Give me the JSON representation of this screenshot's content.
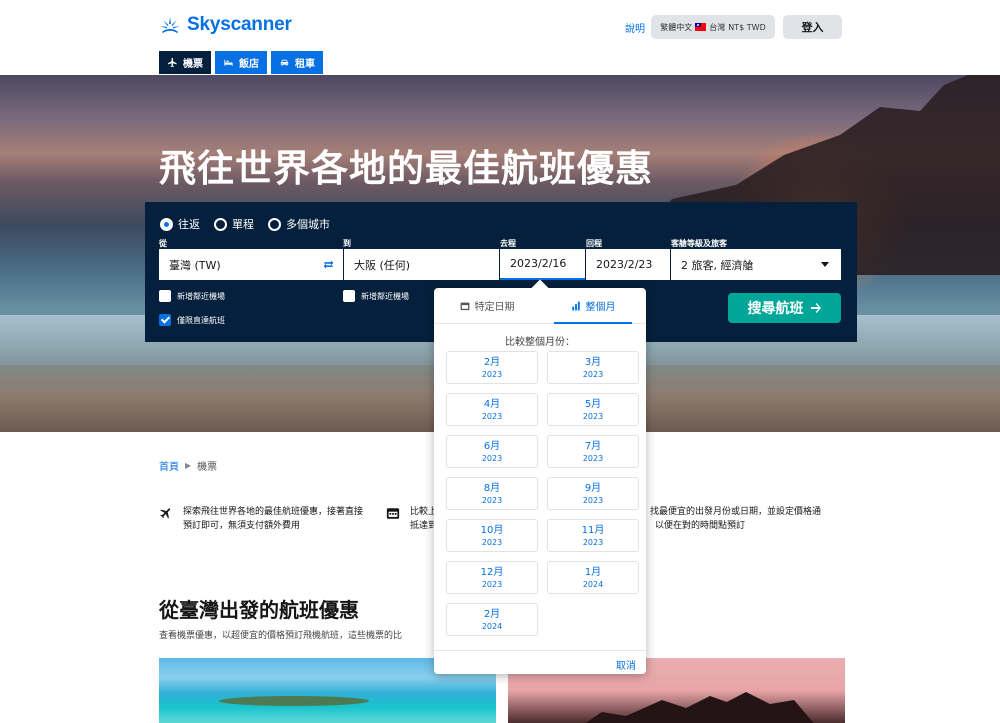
{
  "brand": {
    "name": "Skyscanner",
    "accent": "#0770e3",
    "navy": "#05203c",
    "teal": "#00a698"
  },
  "header": {
    "help": "說明",
    "locale": {
      "language": "繁體中文",
      "region": "台灣",
      "currency": "NT$ TWD"
    },
    "login": "登入"
  },
  "tabs": [
    {
      "label": "機票",
      "icon": "plane-icon",
      "active": true
    },
    {
      "label": "飯店",
      "icon": "bed-icon",
      "active": false
    },
    {
      "label": "租車",
      "icon": "car-icon",
      "active": false
    }
  ],
  "hero": {
    "title": "飛往世界各地的最佳航班優惠"
  },
  "search": {
    "trip_types": [
      {
        "label": "往返",
        "checked": true
      },
      {
        "label": "單程",
        "checked": false
      },
      {
        "label": "多個城市",
        "checked": false
      }
    ],
    "labels": {
      "from": "從",
      "to": "到",
      "depart": "去程",
      "return": "回程",
      "cabin": "客艙等級及旅客"
    },
    "values": {
      "from": "臺灣 (TW)",
      "to": "大阪 (任何)",
      "depart": "2023/2/16",
      "return": "2023/2/23",
      "cabin": "2 旅客, 經濟艙"
    },
    "checkboxes": [
      {
        "label": "新增鄰近機場",
        "checked": false
      },
      {
        "label": "新增鄰近機場",
        "checked": false
      },
      {
        "label": "僅限直達航班",
        "checked": true
      }
    ],
    "submit": "搜尋航班"
  },
  "date_popup": {
    "tabs": [
      {
        "label": "特定日期",
        "icon": "calendar-icon",
        "active": false
      },
      {
        "label": "整個月",
        "icon": "bar-chart-icon",
        "active": true
      }
    ],
    "heading": "比較整個月份：",
    "months": [
      {
        "month": "2月",
        "year": "2023"
      },
      {
        "month": "3月",
        "year": "2023"
      },
      {
        "month": "4月",
        "year": "2023"
      },
      {
        "month": "5月",
        "year": "2023"
      },
      {
        "month": "6月",
        "year": "2023"
      },
      {
        "month": "7月",
        "year": "2023"
      },
      {
        "month": "8月",
        "year": "2023"
      },
      {
        "month": "9月",
        "year": "2023"
      },
      {
        "month": "10月",
        "year": "2023"
      },
      {
        "month": "11月",
        "year": "2023"
      },
      {
        "month": "12月",
        "year": "2023"
      },
      {
        "month": "1月",
        "year": "2024"
      },
      {
        "month": "2月",
        "year": "2024"
      }
    ],
    "cancel": "取消"
  },
  "breadcrumb": {
    "home": "首頁",
    "current": "機票"
  },
  "features": [
    {
      "icon": "plane-icon",
      "line1": "探索飛往世界各地的最佳航班優惠，接著直接",
      "line2": "預訂即可，無須支付額外費用"
    },
    {
      "icon": "calendar-icon",
      "line1": "比較上",
      "line2": "抵達到"
    },
    {
      "icon": "alert-icon",
      "line1": "找最便宜的出發月份或日期，並設定價格通",
      "line2": "以便在對的時間點預訂"
    }
  ],
  "section": {
    "title": "從臺灣出發的航班優惠",
    "subtitle": "查看機票優惠，以超便宜的價格預訂飛機航班，這些機票的比"
  }
}
